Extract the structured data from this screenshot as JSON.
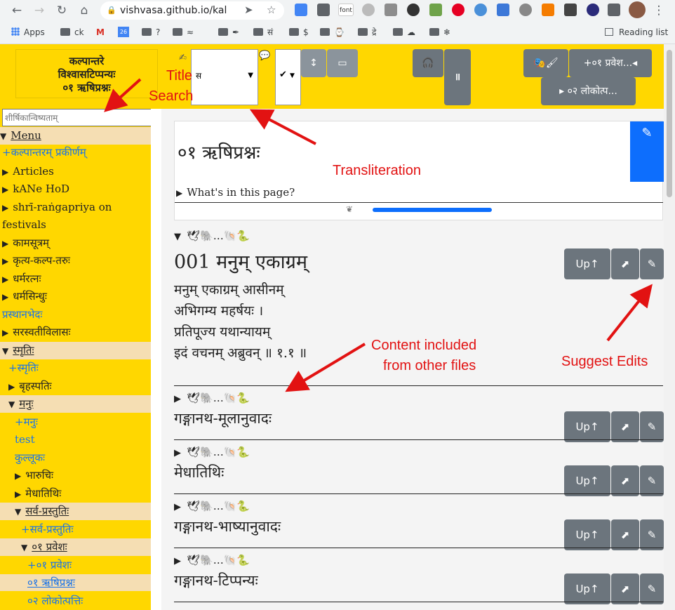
{
  "browser": {
    "url": "vishvasa.github.io/kal",
    "bookmarks": [
      "Apps",
      "ck",
      "?",
      "$"
    ],
    "reading_list": "Reading list",
    "font_ext_label": "font"
  },
  "site": {
    "brand_line1": "कल्पान्तरे",
    "brand_line2": "विश्वासटिप्पन्यः",
    "brand_line3": "०१ ऋषिप्रश्नः",
    "script_select_value": "स",
    "check_select_value": "✔",
    "nav_prev_label": "+०१ प्रवेश...◂",
    "nav_next_label": "▸ ०२ लोकोत्प..."
  },
  "sidebar": {
    "search_placeholder": "शीर्षिकान्विष्यताम्",
    "items": [
      {
        "label": "Menu",
        "tri": "▼"
      },
      {
        "label": "+कल्पान्तरम् प्रकीर्णम्"
      },
      {
        "label": "Articles",
        "tri": "▶"
      },
      {
        "label": "kANe HoD",
        "tri": "▶"
      },
      {
        "label": "shrī-raṅgapriya on",
        "tri": "▶"
      },
      {
        "label": "festivals"
      },
      {
        "label": "कामसूत्रम्",
        "tri": "▶"
      },
      {
        "label": "कृत्य-कल्प-तरुः",
        "tri": "▶"
      },
      {
        "label": "धर्मरत्नः",
        "tri": "▶"
      },
      {
        "label": "धर्मसिन्धुः",
        "tri": "▶"
      },
      {
        "label": "प्रस्थानभेदः"
      },
      {
        "label": "सरस्वतीविलासः",
        "tri": "▶"
      },
      {
        "label": "स्मृतिः",
        "tri": "▼"
      },
      {
        "label": "+स्मृतिः"
      },
      {
        "label": "बृहस्पतिः",
        "tri": "▶"
      },
      {
        "label": "मनुः",
        "tri": "▼"
      },
      {
        "label": "+मनुः"
      },
      {
        "label": "test"
      },
      {
        "label": "कुल्लूकः"
      },
      {
        "label": "भारुचिः",
        "tri": "▶"
      },
      {
        "label": "मेधातिथिः",
        "tri": "▶"
      },
      {
        "label": "सर्व-प्रस्तुतिः",
        "tri": "▼"
      },
      {
        "label": "+सर्व-प्रस्तुतिः"
      },
      {
        "label": "०१ प्रवेशः",
        "tri": "▼"
      },
      {
        "label": "+०१ प्रवेशः"
      },
      {
        "label": "०१ ऋषिप्रश्नः"
      },
      {
        "label": "०२ लोकोत्पत्तिः"
      }
    ]
  },
  "main": {
    "page_title": "०१ ऋषिप्रश्नः",
    "whats_in_page": "What's in this page?",
    "up_label": "Up↑",
    "sections": [
      {
        "head": "…",
        "title": "001 मनुम् एकाग्रम्",
        "verse": [
          "मनुम् एकाग्रम् आसीनम्",
          "अभिगम्य महर्षयः ।",
          "प्रतिपूज्य यथान्यायम्",
          "इदं वचनम् अब्रुवन् ॥ १.१ ॥"
        ]
      },
      {
        "head": "…",
        "title": "गङ्गानथ-मूलानुवादः"
      },
      {
        "head": "…",
        "title": "मेधातिथिः"
      },
      {
        "head": "…",
        "title": "गङ्गानथ-भाष्यानुवादः"
      },
      {
        "head": "…",
        "title": "गङ्गानथ-टिप्पन्यः"
      }
    ]
  },
  "annotations": {
    "title": "Title",
    "search": "Search",
    "transliteration": "Transliteration",
    "content_line1": "Content included",
    "content_line2": "from other files",
    "suggest_edits": "Suggest Edits"
  },
  "colors": {
    "site_yellow": "#ffd700",
    "highlight": "#f5deb3",
    "button_gray": "#6c757d",
    "primary_blue": "#0d6efd",
    "annotation_red": "#e21212"
  }
}
